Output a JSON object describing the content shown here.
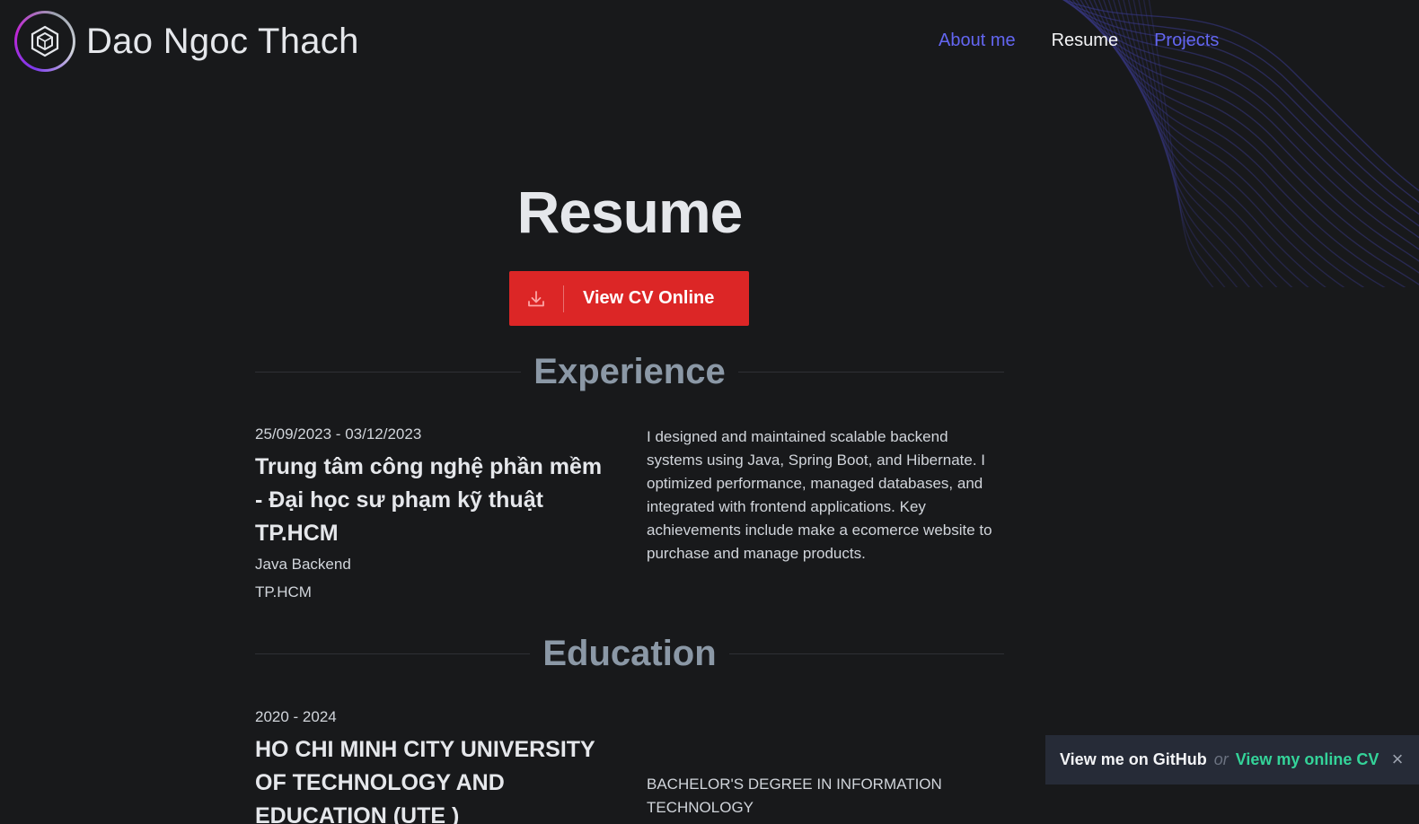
{
  "header": {
    "name": "Dao Ngoc Thach",
    "logo_icon": "hexagon-logo-icon"
  },
  "nav": [
    {
      "label": "About me",
      "active": false
    },
    {
      "label": "Resume",
      "active": true
    },
    {
      "label": "Projects",
      "active": false
    }
  ],
  "main": {
    "title": "Resume",
    "cv_button": {
      "label": "View CV Online",
      "icon": "download-icon"
    }
  },
  "experience": {
    "heading": "Experience",
    "items": [
      {
        "date": "25/09/2023 - 03/12/2023",
        "org": "Trung tâm công nghệ phần mềm - Đại học sư phạm kỹ thuật TP.HCM",
        "role": "Java Backend",
        "location": "TP.HCM",
        "description": "I designed and maintained scalable backend systems using Java, Spring Boot, and Hibernate. I optimized performance, managed databases, and integrated with frontend applications. Key achievements include make a ecomerce website to purchase and manage products."
      }
    ]
  },
  "education": {
    "heading": "Education",
    "items": [
      {
        "date": "2020 - 2024",
        "school": "HO CHI MINH CITY UNIVERSITY OF TECHNOLOGY AND EDUCATION (UTE )",
        "degree": "BACHELOR'S DEGREE IN INFORMATION TECHNOLOGY"
      }
    ]
  },
  "banner": {
    "github": "View me on GitHub",
    "or": "or",
    "online_cv": "View my online CV",
    "close": "×"
  },
  "colors": {
    "background": "#18191b",
    "accent_nav": "#6366f1",
    "button": "#dc2626",
    "banner_link": "#34d399"
  }
}
